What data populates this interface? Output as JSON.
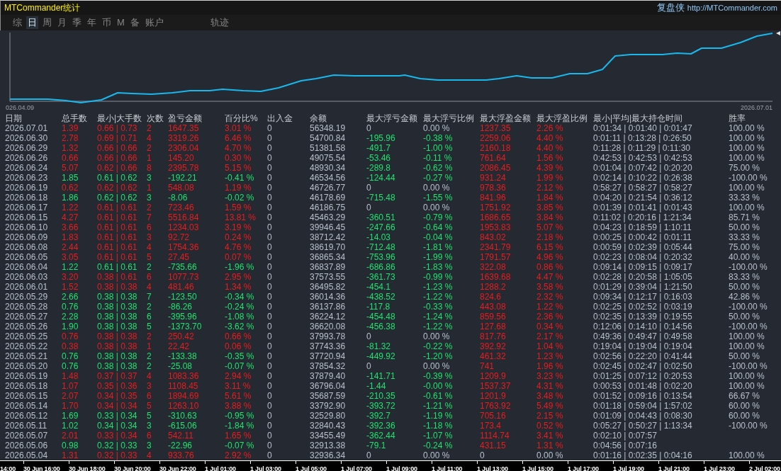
{
  "window": {
    "title": "MTCommander统计",
    "brand": "复盘侠",
    "link": "http://MTCommander.com"
  },
  "tabs": [
    {
      "label": "综",
      "selected": false
    },
    {
      "label": "日",
      "selected": true
    },
    {
      "label": "周",
      "selected": false
    },
    {
      "label": "月",
      "selected": false
    },
    {
      "label": "季",
      "selected": false
    },
    {
      "label": "年",
      "selected": false
    },
    {
      "label": "币",
      "selected": false
    },
    {
      "label": "M",
      "selected": false
    },
    {
      "label": "备",
      "selected": false
    },
    {
      "label": "账户",
      "selected": false
    },
    {
      "label": "轨迹",
      "selected": false
    }
  ],
  "equity_chart": {
    "start_label": "026.04.09",
    "end_label": "2026.07.01"
  },
  "table": {
    "columns": [
      "日期",
      "总手数",
      "最小|大手数",
      "次数",
      "盈亏金额",
      "百分比%",
      "出入金",
      "余额",
      "最大浮亏金额",
      "最大浮亏比例",
      "最大浮盈金额",
      "最大浮盈比例",
      "最小|平均|最大持仓时间",
      "胜率"
    ],
    "rows": [
      {
        "date": "2026.07.01",
        "trade": {
          "color": "#ec1c1c",
          "cells": [
            "1.39",
            "0.66 | 0.73",
            "2",
            "1647.35",
            "3.01 %"
          ]
        },
        "cash_flow": "0",
        "balance": "56348.19",
        "float_loss": {
          "color": "#b8c0cc",
          "cells": [
            "0",
            "0.00 %"
          ]
        },
        "float_profit": {
          "color": "#ec1c1c",
          "cells": [
            "1237.35",
            "2.26 %"
          ]
        },
        "hold_time": "0:01:34 | 0:01:40 | 0:01:47",
        "win_rate": "100.00 %"
      },
      {
        "date": "2026.06.30",
        "trade": {
          "color": "#ec1c1c",
          "cells": [
            "2.78",
            "0.69 | 0.71",
            "4",
            "3319.26",
            "6.46 %"
          ]
        },
        "cash_flow": "0",
        "balance": "54700.84",
        "float_loss": {
          "color": "#1ee56e",
          "cells": [
            "-195.96",
            "-0.38 %"
          ]
        },
        "float_profit": {
          "color": "#ec1c1c",
          "cells": [
            "2259.06",
            "4.40 %"
          ]
        },
        "hold_time": "0:01:11 | 0:13:28 | 0:26:50",
        "win_rate": "100.00 %"
      },
      {
        "date": "2026.06.29",
        "trade": {
          "color": "#ec1c1c",
          "cells": [
            "1.32",
            "0.66 | 0.66",
            "2",
            "2306.04",
            "4.70 %"
          ]
        },
        "cash_flow": "0",
        "balance": "51381.58",
        "float_loss": {
          "color": "#1ee56e",
          "cells": [
            "-491.7",
            "-1.00 %"
          ]
        },
        "float_profit": {
          "color": "#ec1c1c",
          "cells": [
            "2160.18",
            "4.40 %"
          ]
        },
        "hold_time": "0:11:28 | 0:11:29 | 0:11:30",
        "win_rate": "100.00 %"
      },
      {
        "date": "2026.06.26",
        "trade": {
          "color": "#ec1c1c",
          "cells": [
            "0.66",
            "0.66 | 0.66",
            "1",
            "145.20",
            "0.30 %"
          ]
        },
        "cash_flow": "0",
        "balance": "49075.54",
        "float_loss": {
          "color": "#1ee56e",
          "cells": [
            "-53.46",
            "-0.11 %"
          ]
        },
        "float_profit": {
          "color": "#ec1c1c",
          "cells": [
            "761.64",
            "1.56 %"
          ]
        },
        "hold_time": "0:42:53 | 0:42:53 | 0:42:53",
        "win_rate": "100.00 %"
      },
      {
        "date": "2026.06.24",
        "trade": {
          "color": "#ec1c1c",
          "cells": [
            "5.07",
            "0.62 | 0.66",
            "8",
            "2395.78",
            "5.15 %"
          ]
        },
        "cash_flow": "0",
        "balance": "48930.34",
        "float_loss": {
          "color": "#1ee56e",
          "cells": [
            "-289.8",
            "-0.62 %"
          ]
        },
        "float_profit": {
          "color": "#ec1c1c",
          "cells": [
            "2086.45",
            "4.39 %"
          ]
        },
        "hold_time": "0:01:04 | 0:07:42 | 0:20:20",
        "win_rate": "75.00 %"
      },
      {
        "date": "2026.06.23",
        "trade": {
          "color": "#1ee56e",
          "cells": [
            "1.85",
            "0.61 | 0.62",
            "3",
            "-192.21",
            "-0.41 %"
          ]
        },
        "cash_flow": "0",
        "balance": "46534.56",
        "float_loss": {
          "color": "#1ee56e",
          "cells": [
            "-124.44",
            "-0.27 %"
          ]
        },
        "float_profit": {
          "color": "#ec1c1c",
          "cells": [
            "931.24",
            "1.99 %"
          ]
        },
        "hold_time": "0:02:14 | 0:10:22 | 0:26:38",
        "win_rate": "-100.00 %"
      },
      {
        "date": "2026.06.19",
        "trade": {
          "color": "#ec1c1c",
          "cells": [
            "0.62",
            "0.62 | 0.62",
            "1",
            "548.08",
            "1.19 %"
          ]
        },
        "cash_flow": "0",
        "balance": "46726.77",
        "float_loss": {
          "color": "#b8c0cc",
          "cells": [
            "0",
            "0.00 %"
          ]
        },
        "float_profit": {
          "color": "#ec1c1c",
          "cells": [
            "978.36",
            "2.12 %"
          ]
        },
        "hold_time": "0:58:27 | 0:58:27 | 0:58:27",
        "win_rate": "100.00 %"
      },
      {
        "date": "2026.06.18",
        "trade": {
          "color": "#1ee56e",
          "cells": [
            "1.86",
            "0.62 | 0.62",
            "3",
            "-8.06",
            "-0.02 %"
          ]
        },
        "cash_flow": "0",
        "balance": "46178.69",
        "float_loss": {
          "color": "#1ee56e",
          "cells": [
            "-715.48",
            "-1.55 %"
          ]
        },
        "float_profit": {
          "color": "#ec1c1c",
          "cells": [
            "841.96",
            "1.84 %"
          ]
        },
        "hold_time": "0:04:20 | 0:21:54 | 0:36:12",
        "win_rate": "33.33 %"
      },
      {
        "date": "2026.06.17",
        "trade": {
          "color": "#ec1c1c",
          "cells": [
            "1.22",
            "0.61 | 0.61",
            "2",
            "723.46",
            "1.59 %"
          ]
        },
        "cash_flow": "0",
        "balance": "46186.75",
        "float_loss": {
          "color": "#b8c0cc",
          "cells": [
            "0",
            "0.00 %"
          ]
        },
        "float_profit": {
          "color": "#ec1c1c",
          "cells": [
            "1751.92",
            "3.85 %"
          ]
        },
        "hold_time": "0:01:39 | 0:01:41 | 0:01:43",
        "win_rate": "100.00 %"
      },
      {
        "date": "2026.06.15",
        "trade": {
          "color": "#ec1c1c",
          "cells": [
            "4.27",
            "0.61 | 0.61",
            "7",
            "5516.84",
            "13.81 %"
          ]
        },
        "cash_flow": "0",
        "balance": "45463.29",
        "float_loss": {
          "color": "#1ee56e",
          "cells": [
            "-360.51",
            "-0.79 %"
          ]
        },
        "float_profit": {
          "color": "#ec1c1c",
          "cells": [
            "1686.65",
            "3.84 %"
          ]
        },
        "hold_time": "0:11:02 | 0:20:16 | 1:21:34",
        "win_rate": "85.71 %"
      },
      {
        "date": "2026.06.10",
        "trade": {
          "color": "#ec1c1c",
          "cells": [
            "3.66",
            "0.61 | 0.61",
            "6",
            "1234.03",
            "3.19 %"
          ]
        },
        "cash_flow": "0",
        "balance": "39946.45",
        "float_loss": {
          "color": "#1ee56e",
          "cells": [
            "-247.66",
            "-0.64 %"
          ]
        },
        "float_profit": {
          "color": "#ec1c1c",
          "cells": [
            "1953.83",
            "5.07 %"
          ]
        },
        "hold_time": "0:04:23 | 0:18:59 | 1:10:11",
        "win_rate": "50.00 %"
      },
      {
        "date": "2026.06.09",
        "trade": {
          "color": "#ec1c1c",
          "cells": [
            "1.83",
            "0.61 | 0.61",
            "3",
            "92.72",
            "0.24 %"
          ]
        },
        "cash_flow": "0",
        "balance": "38712.42",
        "float_loss": {
          "color": "#1ee56e",
          "cells": [
            "-14.03",
            "-0.04 %"
          ]
        },
        "float_profit": {
          "color": "#ec1c1c",
          "cells": [
            "843.02",
            "2.18 %"
          ]
        },
        "hold_time": "0:00:25 | 0:00:42 | 0:01:11",
        "win_rate": "33.33 %"
      },
      {
        "date": "2026.06.08",
        "trade": {
          "color": "#ec1c1c",
          "cells": [
            "2.44",
            "0.61 | 0.61",
            "4",
            "1754.36",
            "4.76 %"
          ]
        },
        "cash_flow": "0",
        "balance": "38619.70",
        "float_loss": {
          "color": "#1ee56e",
          "cells": [
            "-712.48",
            "-1.81 %"
          ]
        },
        "float_profit": {
          "color": "#ec1c1c",
          "cells": [
            "2341.79",
            "6.15 %"
          ]
        },
        "hold_time": "0:00:59 | 0:02:39 | 0:05:44",
        "win_rate": "75.00 %"
      },
      {
        "date": "2026.06.05",
        "trade": {
          "color": "#ec1c1c",
          "cells": [
            "3.05",
            "0.61 | 0.61",
            "5",
            "27.45",
            "0.07 %"
          ]
        },
        "cash_flow": "0",
        "balance": "36865.34",
        "float_loss": {
          "color": "#1ee56e",
          "cells": [
            "-753.96",
            "-1.99 %"
          ]
        },
        "float_profit": {
          "color": "#ec1c1c",
          "cells": [
            "1791.57",
            "4.96 %"
          ]
        },
        "hold_time": "0:02:23 | 0:08:04 | 0:20:32",
        "win_rate": "40.00 %"
      },
      {
        "date": "2026.06.04",
        "trade": {
          "color": "#1ee56e",
          "cells": [
            "1.22",
            "0.61 | 0.61",
            "2",
            "-735.66",
            "-1.96 %"
          ]
        },
        "cash_flow": "0",
        "balance": "36837.89",
        "float_loss": {
          "color": "#1ee56e",
          "cells": [
            "-686.86",
            "-1.83 %"
          ]
        },
        "float_profit": {
          "color": "#ec1c1c",
          "cells": [
            "322.08",
            "0.86 %"
          ]
        },
        "hold_time": "0:09:14 | 0:09:15 | 0:09:17",
        "win_rate": "-100.00 %"
      },
      {
        "date": "2026.06.03",
        "trade": {
          "color": "#ec1c1c",
          "cells": [
            "3.20",
            "0.38 | 0.61",
            "6",
            "1077.73",
            "2.95 %"
          ]
        },
        "cash_flow": "0",
        "balance": "37573.55",
        "float_loss": {
          "color": "#1ee56e",
          "cells": [
            "-361.73",
            "-0.99 %"
          ]
        },
        "float_profit": {
          "color": "#ec1c1c",
          "cells": [
            "1639.68",
            "4.47 %"
          ]
        },
        "hold_time": "0:02:28 | 0:20:58 | 1:05:05",
        "win_rate": "83.33 %"
      },
      {
        "date": "2026.06.01",
        "trade": {
          "color": "#ec1c1c",
          "cells": [
            "1.52",
            "0.38 | 0.38",
            "4",
            "481.46",
            "1.34 %"
          ]
        },
        "cash_flow": "0",
        "balance": "36495.82",
        "float_loss": {
          "color": "#1ee56e",
          "cells": [
            "-454.1",
            "-1.23 %"
          ]
        },
        "float_profit": {
          "color": "#ec1c1c",
          "cells": [
            "1288.2",
            "3.58 %"
          ]
        },
        "hold_time": "0:01:29 | 0:39:04 | 1:21:50",
        "win_rate": "50.00 %"
      },
      {
        "date": "2026.05.29",
        "trade": {
          "color": "#1ee56e",
          "cells": [
            "2.66",
            "0.38 | 0.38",
            "7",
            "-123.50",
            "-0.34 %"
          ]
        },
        "cash_flow": "0",
        "balance": "36014.36",
        "float_loss": {
          "color": "#1ee56e",
          "cells": [
            "-438.52",
            "-1.22 %"
          ]
        },
        "float_profit": {
          "color": "#ec1c1c",
          "cells": [
            "824.6",
            "2.32 %"
          ]
        },
        "hold_time": "0:09:34 | 0:12:17 | 0:16:03",
        "win_rate": "42.86 %"
      },
      {
        "date": "2026.05.28",
        "trade": {
          "color": "#1ee56e",
          "cells": [
            "0.76",
            "0.38 | 0.38",
            "2",
            "-86.26",
            "-0.24 %"
          ]
        },
        "cash_flow": "0",
        "balance": "36137.86",
        "float_loss": {
          "color": "#1ee56e",
          "cells": [
            "-117.8",
            "-0.33 %"
          ]
        },
        "float_profit": {
          "color": "#ec1c1c",
          "cells": [
            "443.08",
            "1.22 %"
          ]
        },
        "hold_time": "0:02:25 | 0:02:52 | 0:03:19",
        "win_rate": "-100.00 %"
      },
      {
        "date": "2026.05.27",
        "trade": {
          "color": "#1ee56e",
          "cells": [
            "2.28",
            "0.38 | 0.38",
            "6",
            "-395.96",
            "-1.08 %"
          ]
        },
        "cash_flow": "0",
        "balance": "36224.12",
        "float_loss": {
          "color": "#1ee56e",
          "cells": [
            "-454.48",
            "-1.24 %"
          ]
        },
        "float_profit": {
          "color": "#ec1c1c",
          "cells": [
            "859.56",
            "2.36 %"
          ]
        },
        "hold_time": "0:02:35 | 0:13:39 | 0:19:55",
        "win_rate": "50.00 %"
      },
      {
        "date": "2026.05.26",
        "trade": {
          "color": "#1ee56e",
          "cells": [
            "1.90",
            "0.38 | 0.38",
            "5",
            "-1373.70",
            "-3.62 %"
          ]
        },
        "cash_flow": "0",
        "balance": "36620.08",
        "float_loss": {
          "color": "#1ee56e",
          "cells": [
            "-456.38",
            "-1.22 %"
          ]
        },
        "float_profit": {
          "color": "#ec1c1c",
          "cells": [
            "127.68",
            "0.34 %"
          ]
        },
        "hold_time": "0:12:06 | 0:14:10 | 0:14:56",
        "win_rate": "-100.00 %"
      },
      {
        "date": "2026.05.25",
        "trade": {
          "color": "#ec1c1c",
          "cells": [
            "0.76",
            "0.38 | 0.38",
            "2",
            "250.42",
            "0.66 %"
          ]
        },
        "cash_flow": "0",
        "balance": "37993.78",
        "float_loss": {
          "color": "#b8c0cc",
          "cells": [
            "0",
            "0.00 %"
          ]
        },
        "float_profit": {
          "color": "#ec1c1c",
          "cells": [
            "817.76",
            "2.17 %"
          ]
        },
        "hold_time": "0:49:36 | 0:49:47 | 0:49:58",
        "win_rate": "100.00 %"
      },
      {
        "date": "2026.05.22",
        "trade": {
          "color": "#ec1c1c",
          "cells": [
            "0.38",
            "0.38 | 0.38",
            "1",
            "22.42",
            "0.06 %"
          ]
        },
        "cash_flow": "0",
        "balance": "37743.36",
        "float_loss": {
          "color": "#1ee56e",
          "cells": [
            "-81.32",
            "-0.22 %"
          ]
        },
        "float_profit": {
          "color": "#ec1c1c",
          "cells": [
            "392.92",
            "1.04 %"
          ]
        },
        "hold_time": "0:19:04 | 0:19:04 | 0:19:04",
        "win_rate": "100.00 %"
      },
      {
        "date": "2026.05.21",
        "trade": {
          "color": "#1ee56e",
          "cells": [
            "0.76",
            "0.38 | 0.38",
            "2",
            "-133.38",
            "-0.35 %"
          ]
        },
        "cash_flow": "0",
        "balance": "37720.94",
        "float_loss": {
          "color": "#1ee56e",
          "cells": [
            "-449.92",
            "-1.20 %"
          ]
        },
        "float_profit": {
          "color": "#ec1c1c",
          "cells": [
            "461.32",
            "1.23 %"
          ]
        },
        "hold_time": "0:02:56 | 0:22:20 | 0:41:44",
        "win_rate": "50.00 %"
      },
      {
        "date": "2026.05.20",
        "trade": {
          "color": "#1ee56e",
          "cells": [
            "0.76",
            "0.38 | 0.38",
            "2",
            "-25.08",
            "-0.07 %"
          ]
        },
        "cash_flow": "0",
        "balance": "37854.32",
        "float_loss": {
          "color": "#b8c0cc",
          "cells": [
            "0",
            "0.00 %"
          ]
        },
        "float_profit": {
          "color": "#ec1c1c",
          "cells": [
            "741",
            "1.96 %"
          ]
        },
        "hold_time": "0:02:45 | 0:02:47 | 0:02:50",
        "win_rate": "-100.00 %"
      },
      {
        "date": "2026.05.19",
        "trade": {
          "color": "#ec1c1c",
          "cells": [
            "1.48",
            "0.37 | 0.37",
            "4",
            "1083.36",
            "2.94 %"
          ]
        },
        "cash_flow": "0",
        "balance": "37879.40",
        "float_loss": {
          "color": "#1ee56e",
          "cells": [
            "-141.71",
            "-0.39 %"
          ]
        },
        "float_profit": {
          "color": "#ec1c1c",
          "cells": [
            "1209.9",
            "3.23 %"
          ]
        },
        "hold_time": "0:01:25 | 0:07:12 | 0:20:53",
        "win_rate": "100.00 %"
      },
      {
        "date": "2026.05.18",
        "trade": {
          "color": "#ec1c1c",
          "cells": [
            "1.07",
            "0.35 | 0.36",
            "3",
            "1108.45",
            "3.11 %"
          ]
        },
        "cash_flow": "0",
        "balance": "36796.04",
        "float_loss": {
          "color": "#1ee56e",
          "cells": [
            "-1.44",
            "-0.00 %"
          ]
        },
        "float_profit": {
          "color": "#ec1c1c",
          "cells": [
            "1537.37",
            "4.31 %"
          ]
        },
        "hold_time": "0:00:53 | 0:01:48 | 0:02:20",
        "win_rate": "100.00 %"
      },
      {
        "date": "2026.05.15",
        "trade": {
          "color": "#ec1c1c",
          "cells": [
            "2.07",
            "0.34 | 0.35",
            "6",
            "1894.69",
            "5.61 %"
          ]
        },
        "cash_flow": "0",
        "balance": "35687.59",
        "float_loss": {
          "color": "#1ee56e",
          "cells": [
            "-210.35",
            "-0.61 %"
          ]
        },
        "float_profit": {
          "color": "#ec1c1c",
          "cells": [
            "1201.9",
            "3.48 %"
          ]
        },
        "hold_time": "0:01:52 | 0:09:16 | 0:13:54",
        "win_rate": "66.67 %"
      },
      {
        "date": "2026.05.14",
        "trade": {
          "color": "#ec1c1c",
          "cells": [
            "1.70",
            "0.34 | 0.34",
            "5",
            "1263.10",
            "3.88 %"
          ]
        },
        "cash_flow": "0",
        "balance": "33792.90",
        "float_loss": {
          "color": "#1ee56e",
          "cells": [
            "-393.72",
            "-1.21 %"
          ]
        },
        "float_profit": {
          "color": "#ec1c1c",
          "cells": [
            "1763.92",
            "5.49 %"
          ]
        },
        "hold_time": "0:01:18 | 0:59:04 | 1:57:02",
        "win_rate": "60.00 %"
      },
      {
        "date": "2026.05.12",
        "trade": {
          "color": "#1ee56e",
          "cells": [
            "1.69",
            "0.33 | 0.34",
            "5",
            "-310.63",
            "-0.95 %"
          ]
        },
        "cash_flow": "0",
        "balance": "32529.80",
        "float_loss": {
          "color": "#1ee56e",
          "cells": [
            "-392.7",
            "-1.19 %"
          ]
        },
        "float_profit": {
          "color": "#ec1c1c",
          "cells": [
            "705.16",
            "2.15 %"
          ]
        },
        "hold_time": "0:01:09 | 0:04:43 | 0:08:30",
        "win_rate": "60.00 %"
      },
      {
        "date": "2026.05.11",
        "trade": {
          "color": "#1ee56e",
          "cells": [
            "1.02",
            "0.34 | 0.34",
            "3",
            "-615.06",
            "-1.84 %"
          ]
        },
        "cash_flow": "0",
        "balance": "32840.43",
        "float_loss": {
          "color": "#1ee56e",
          "cells": [
            "-392.36",
            "-1.18 %"
          ]
        },
        "float_profit": {
          "color": "#ec1c1c",
          "cells": [
            "173.4",
            "0.52 %"
          ]
        },
        "hold_time": "0:05:27 | 0:50:27 | 1:13:34",
        "win_rate": "-100.00 %"
      },
      {
        "date": "2026.05.07",
        "trade": {
          "color": "#ec1c1c",
          "cells": [
            "2.01",
            "0.33 | 0.34",
            "6",
            "542.11",
            "1.65 %"
          ]
        },
        "cash_flow": "0",
        "balance": "33455.49",
        "float_loss": {
          "color": "#1ee56e",
          "cells": [
            "-362.44",
            "-1.07 %"
          ]
        },
        "float_profit": {
          "color": "#ec1c1c",
          "cells": [
            "1114.74",
            "3.41 %"
          ]
        },
        "hold_time": "0:02:10 | 0:07:57"
      },
      {
        "date": "2026.05.06",
        "trade": {
          "color": "#1ee56e",
          "cells": [
            "0.98",
            "0.32 | 0.33",
            "3",
            "-22.96",
            "-0.07 %"
          ]
        },
        "cash_flow": "0",
        "balance": "32913.38",
        "float_loss": {
          "color": "#1ee56e",
          "cells": [
            "-79.1",
            "-0.24 %"
          ]
        },
        "float_profit": {
          "color": "#ec1c1c",
          "cells": [
            "431.15",
            "1.31 %"
          ]
        },
        "hold_time": "0:04:56 | 0:07:16"
      },
      {
        "date": "2026.05.04",
        "trade": {
          "color": "#ec1c1c",
          "cells": [
            "1.31",
            "0.32 | 0.33",
            "4",
            "933.76",
            "2.92 %"
          ]
        },
        "cash_flow": "0",
        "balance": "32936.34",
        "float_loss": {
          "color": "#b8c0cc",
          "cells": [
            "0",
            "0.00 %"
          ]
        },
        "float_profit": {
          "color": "#b8c0cc",
          "cells": [
            "0",
            "0.00 %"
          ]
        },
        "hold_time": "0:01:16 | 0:02:35 | 0:04:16",
        "win_rate": "100.00 %"
      }
    ]
  },
  "time_axis": [
    "14:00",
    "30 Jun 16:00",
    "30 Jun 18:00",
    "30 Jun 20:00",
    "30 Jun 22:00",
    "1 Jul 01:00",
    "1 Jul 03:00",
    "1 Jul 05:00",
    "1 Jul 07:00",
    "1 Jul 09:00",
    "1 Jul 11:00",
    "1 Jul 13:00",
    "1 Jul 15:00",
    "1 Jul 17:00",
    "1 Jul 19:00",
    "1 Jul 21:00",
    "1 Jul 23:00",
    "2 Jul 02:00"
  ]
}
